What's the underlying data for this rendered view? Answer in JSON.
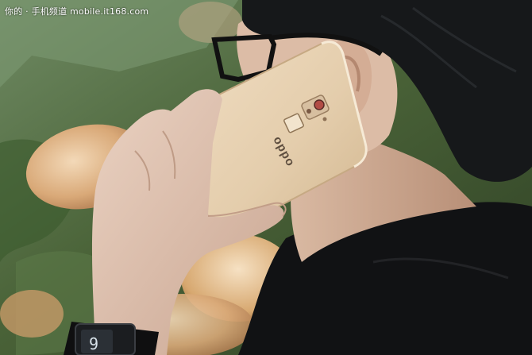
{
  "photo": {
    "subject": "",
    "watermark": "你的 · 手机频道 mobile.it168.com",
    "phone_brand": "oppo",
    "watch_display": "9"
  },
  "colors": {
    "wall_green": "#4f6a3d",
    "phone_gold": "#e4cfb0",
    "skin": "#e0c2ad",
    "hair": "#16181a",
    "shirt": "#111214"
  }
}
